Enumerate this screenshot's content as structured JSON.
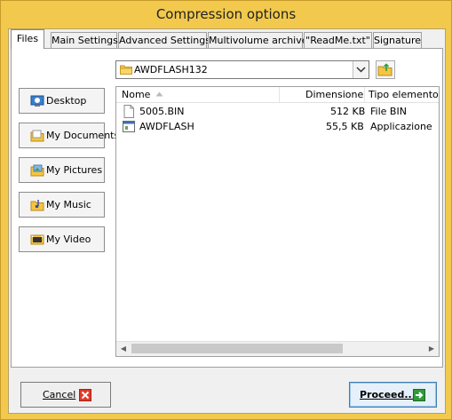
{
  "window": {
    "title": "Compression options"
  },
  "tabs": [
    {
      "label": "Files"
    },
    {
      "label": "Main Settings"
    },
    {
      "label": "Advanced Settings"
    },
    {
      "label": "Multivolume archive"
    },
    {
      "label": "\"ReadMe.txt\""
    },
    {
      "label": "Signature"
    }
  ],
  "path": {
    "current": "AWDFLASH132"
  },
  "places": [
    {
      "label": "Desktop",
      "icon": "desktop-icon"
    },
    {
      "label": "My Documents",
      "icon": "documents-icon"
    },
    {
      "label": "My Pictures",
      "icon": "pictures-icon"
    },
    {
      "label": "My Music",
      "icon": "music-icon"
    },
    {
      "label": "My Video",
      "icon": "video-icon"
    }
  ],
  "filelist": {
    "columns": [
      "Nome",
      "Dimensione",
      "Tipo elemento"
    ],
    "rows": [
      {
        "name": "5005.BIN",
        "size": "512 KB",
        "type": "File BIN",
        "icon": "file-icon"
      },
      {
        "name": "AWDFLASH",
        "size": "55,5 KB",
        "type": "Applicazione",
        "icon": "application-icon"
      }
    ]
  },
  "buttons": {
    "cancel": "Cancel",
    "proceed": "Proceed..."
  },
  "colors": {
    "frame": "#f2c94c",
    "cancel_icon": "#e03a2a",
    "proceed_icon": "#2f9a3a"
  }
}
